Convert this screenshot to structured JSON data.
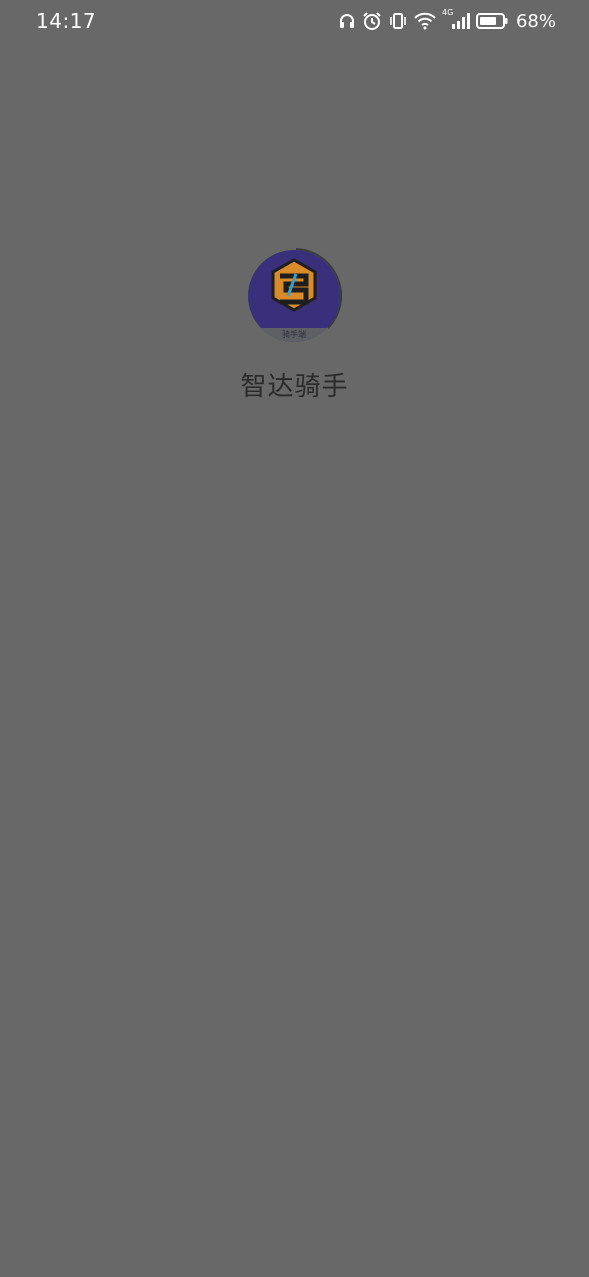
{
  "status_bar": {
    "time": "14:17",
    "battery_percent": "68%",
    "network_type": "4G",
    "icons": [
      "headphones-icon",
      "alarm-icon",
      "vibrate-icon",
      "wifi-icon",
      "cellular-signal-icon",
      "battery-icon"
    ]
  },
  "splash": {
    "app_name": "智达骑手",
    "logo_caption": "骑手端"
  },
  "colors": {
    "background": "#686868",
    "logo_circle": "#3a2f7a",
    "logo_accent": "#d98b2b",
    "app_name_text": "#2b2b2b"
  }
}
